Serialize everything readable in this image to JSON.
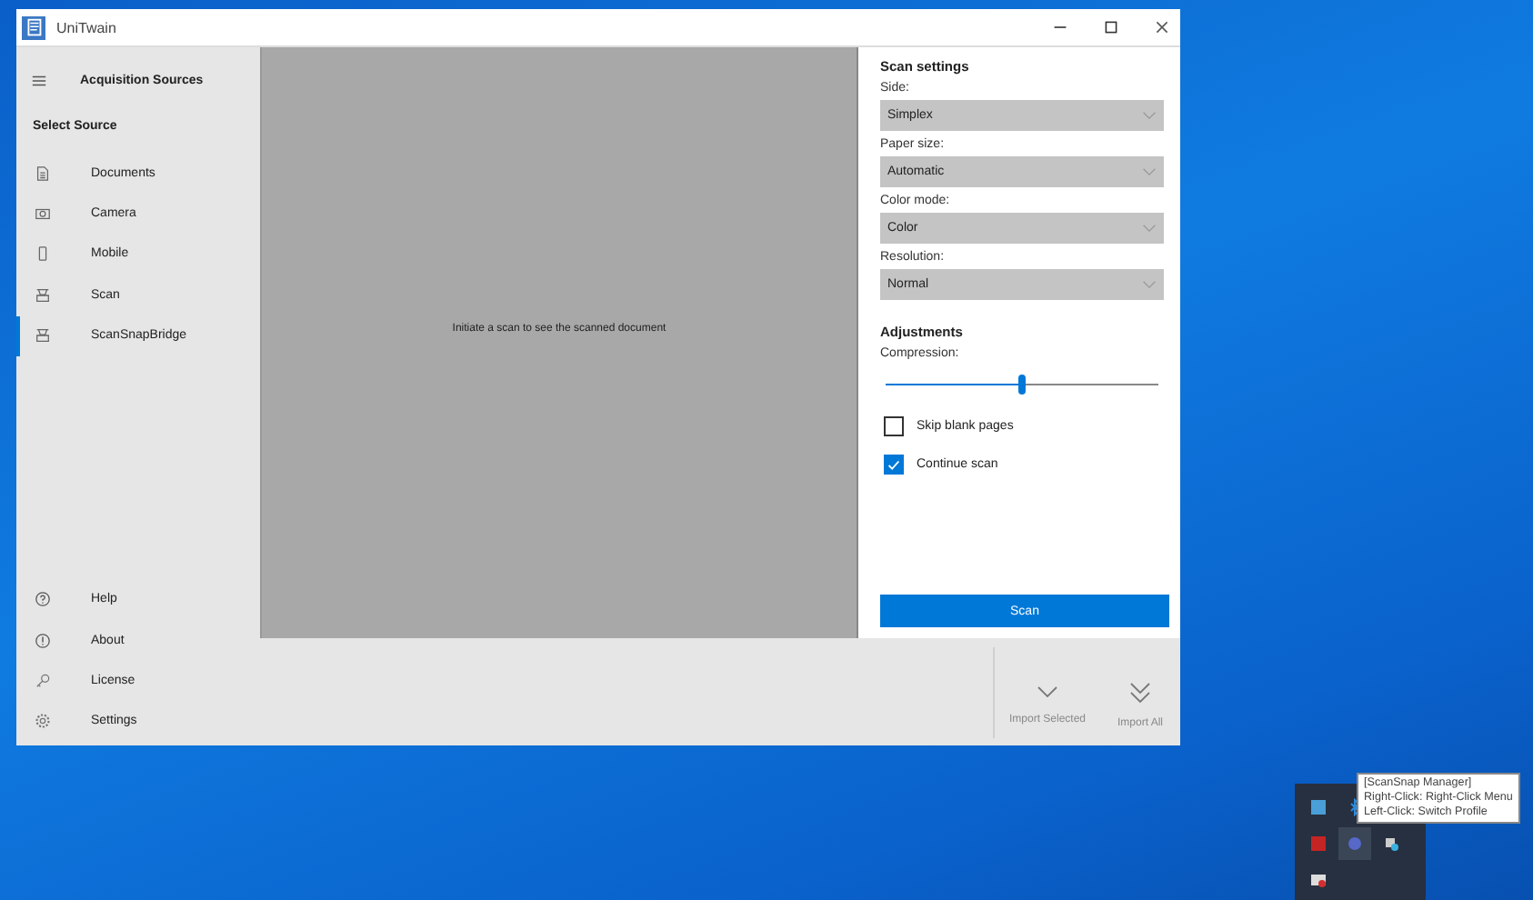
{
  "window": {
    "title": "UniTwain"
  },
  "sidebar": {
    "header": "Acquisition Sources",
    "section_title": "Select Source",
    "sources": [
      {
        "label": "Documents",
        "kind": "document",
        "selected": false
      },
      {
        "label": "Camera",
        "kind": "camera",
        "selected": false
      },
      {
        "label": "Mobile",
        "kind": "phone",
        "selected": false
      },
      {
        "label": "Scan",
        "kind": "scanner",
        "selected": false
      },
      {
        "label": "ScanSnapBridge",
        "kind": "scanner",
        "selected": true
      }
    ],
    "footer_items": [
      {
        "label": "Help",
        "kind": "help"
      },
      {
        "label": "About",
        "kind": "info"
      },
      {
        "label": "License",
        "kind": "key"
      },
      {
        "label": "Settings",
        "kind": "gear"
      }
    ]
  },
  "preview": {
    "message": "Initiate a scan to see the scanned document"
  },
  "settings": {
    "title": "Scan settings",
    "dropdowns": [
      {
        "label": "Side:",
        "value": "Simplex"
      },
      {
        "label": "Paper size:",
        "value": "Automatic"
      },
      {
        "label": "Color mode:",
        "value": "Color"
      },
      {
        "label": "Resolution:",
        "value": "Normal"
      }
    ],
    "adjustments_title": "Adjustments",
    "slider": {
      "label": "Compression:",
      "level": 0.5
    },
    "checkboxes": [
      {
        "label": "Skip blank pages",
        "checked": false
      },
      {
        "label": "Continue scan",
        "checked": true
      }
    ],
    "scan_button": "Scan"
  },
  "import_buttons": [
    {
      "label": "Import Selected",
      "kind": "single"
    },
    {
      "label": "Import All",
      "kind": "double"
    }
  ],
  "tooltip": {
    "lines": [
      "[ScanSnap Manager]",
      "Right-Click: Right-Click Menu",
      "Left-Click: Switch Profile"
    ]
  }
}
